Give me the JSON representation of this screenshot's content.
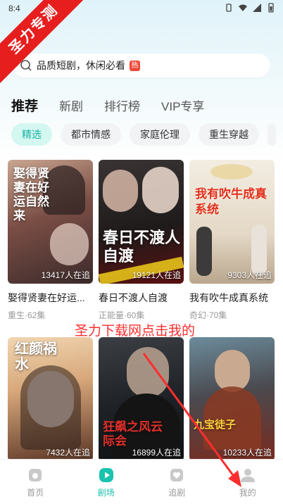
{
  "status": {
    "time": "8:4"
  },
  "ribbon": {
    "text": "圣力专测"
  },
  "search": {
    "text": "品质短剧，休闲必看",
    "badge": "热"
  },
  "tabs": [
    {
      "label": "推荐",
      "active": true
    },
    {
      "label": "新剧",
      "active": false
    },
    {
      "label": "排行榜",
      "active": false
    },
    {
      "label": "VIP专享",
      "active": false
    }
  ],
  "chips": [
    {
      "label": "精选",
      "active": true
    },
    {
      "label": "都市情感",
      "active": false
    },
    {
      "label": "家庭伦理",
      "active": false
    },
    {
      "label": "重生穿越",
      "active": false
    }
  ],
  "cards": [
    {
      "name": "娶得贤妻在好运...",
      "meta": "重生·62集",
      "views": "13417人在追",
      "poster_text": "娶得贤妻在好运自然来"
    },
    {
      "name": "春日不渡人自渡",
      "meta": "正能量·60集",
      "views": "19121人在追",
      "poster_text": "春日不渡人自渡"
    },
    {
      "name": "我有吹牛成真系统",
      "meta": "奇幻·70集",
      "views": "9303人在追",
      "poster_text": "我有吹牛成真系统"
    },
    {
      "name": "",
      "meta": "",
      "views": "7432人在追",
      "poster_text": "红颜祸水"
    },
    {
      "name": "",
      "meta": "",
      "views": "16899人在追",
      "poster_text": "狂飙之风云际会"
    },
    {
      "name": "",
      "meta": "",
      "views": "10233人在追",
      "poster_text": "九宝徒子"
    }
  ],
  "overlay": {
    "text": "圣力下载网点击我的"
  },
  "nav": [
    {
      "label": "首页",
      "icon": "home-icon",
      "active": false
    },
    {
      "label": "剧场",
      "icon": "play-icon",
      "active": true
    },
    {
      "label": "追剧",
      "icon": "heart-icon",
      "active": false
    },
    {
      "label": "我的",
      "icon": "user-icon",
      "active": false
    }
  ],
  "colors": {
    "accent": "#19c3ad",
    "ribbon": "#e61e1e",
    "overlay": "#ff2e2e"
  }
}
